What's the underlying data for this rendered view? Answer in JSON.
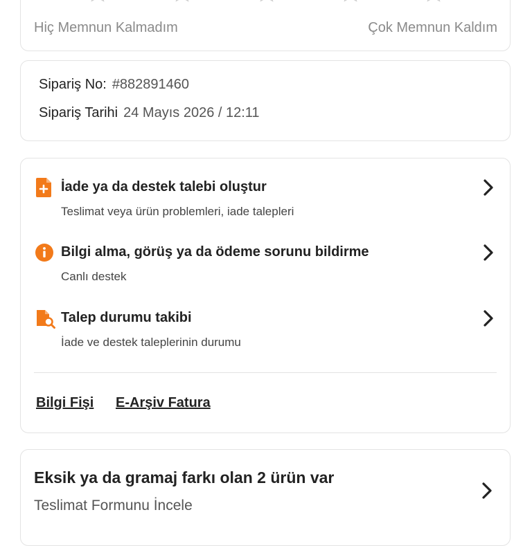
{
  "rating": {
    "star_count": 5,
    "star_color": "#cfcfcf",
    "low_label": "Hiç Memnun Kalmadım",
    "high_label": "Çok Memnun Kaldım"
  },
  "order": {
    "number_label": "Sipariş No:",
    "number_value": "#882891460",
    "date_label": "Sipariş Tarihi",
    "date_value": "24 Mayıs 2026 / 12:11"
  },
  "support": {
    "accent_color": "#f27a1a",
    "items": [
      {
        "icon": "document-plus-icon",
        "title": "İade ya da destek talebi oluştur",
        "subtitle": "Teslimat veya ürün problemleri, iade talepleri"
      },
      {
        "icon": "info-icon",
        "title": "Bilgi alma, görüş ya da ödeme sorunu bildirme",
        "subtitle": "Canlı destek"
      },
      {
        "icon": "document-search-icon",
        "title": "Talep durumu takibi",
        "subtitle": "İade ve destek taleplerinin durumu"
      }
    ],
    "links": {
      "receipt": "Bilgi Fişi",
      "invoice": "E-Arşiv Fatura"
    }
  },
  "missing": {
    "title": "Eksik ya da gramaj farkı olan 2 ürün var",
    "subtitle": "Teslimat Formunu İncele"
  }
}
